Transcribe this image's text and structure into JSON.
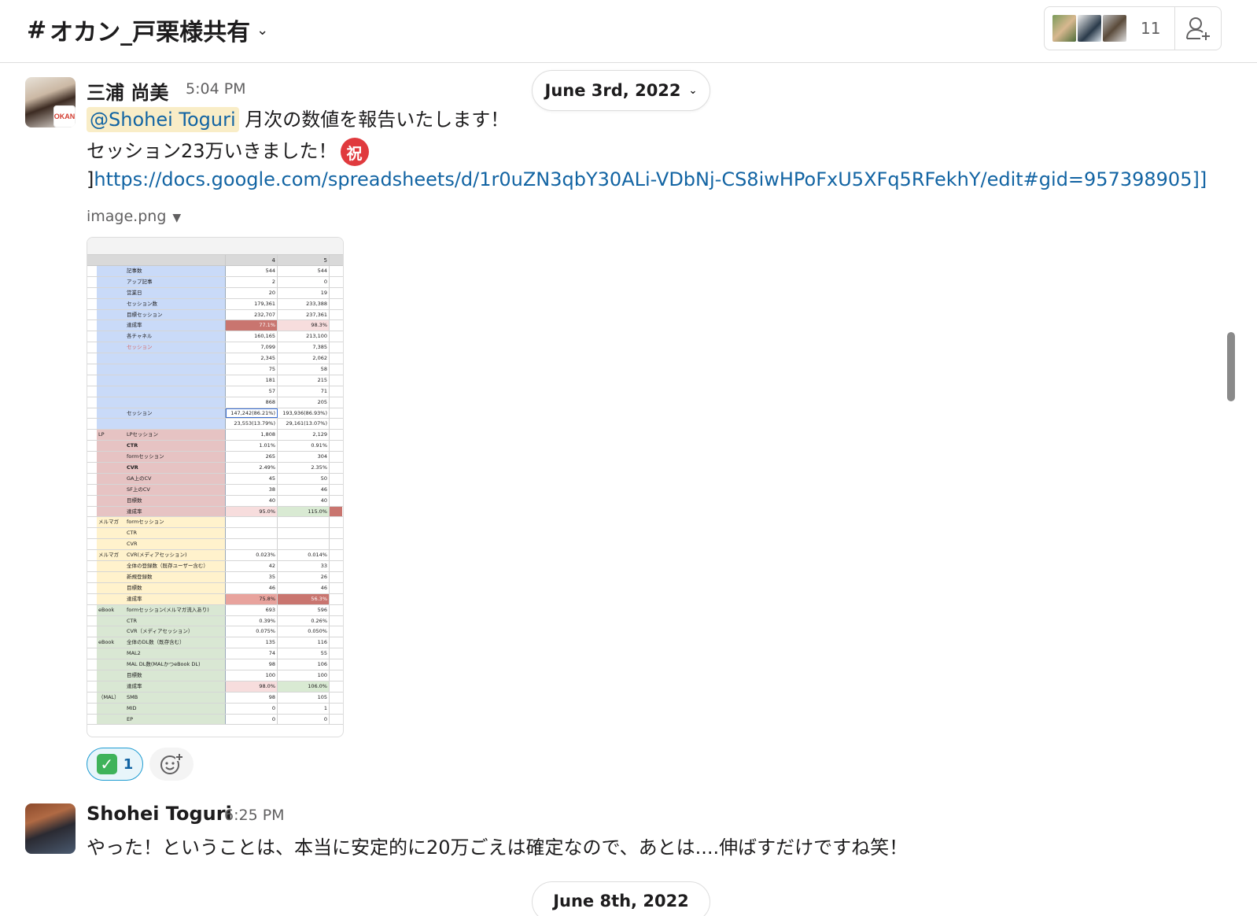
{
  "header": {
    "channel_hash": "#",
    "channel_name": "オカン_戸栗様共有",
    "member_count": "11"
  },
  "date_pills": {
    "top": "June 3rd, 2022",
    "bottom": "June 8th, 2022"
  },
  "messages": [
    {
      "sender": "三浦 尚美",
      "time": "5:04 PM",
      "avatar_badge": "OKAN",
      "mention": "@Shohei Toguri",
      "line1_rest": " 月次の数値を報告いたします！",
      "line2": "セッション23万いきました！",
      "emoji_iwai": "祝",
      "link_prefix": "]",
      "link": "https://docs.google.com/spreadsheets/d/1r0uZN3qbY30ALi-VDbNj-CS8iwHPoFxU5XFq5RFekhY/edit#gid=957398905]]",
      "file_name": "image.png",
      "reaction_count": "1"
    },
    {
      "sender": "Shohei Toguri",
      "time": "6:25 PM",
      "text": "やった！ということは、本当に安定的に20万ごえは確定なので、あとは....伸ばすだけですね笑！"
    }
  ],
  "sheet": {
    "col_headers": [
      "4",
      "5"
    ],
    "rows": [
      {
        "g": "blue",
        "a": "",
        "b": "記事数",
        "v1": "544",
        "v2": "544"
      },
      {
        "g": "blue",
        "a": "",
        "b": "アップ記事",
        "v1": "2",
        "v2": "0"
      },
      {
        "g": "blue",
        "a": "",
        "b": "営業日",
        "v1": "20",
        "v2": "19"
      },
      {
        "g": "blue",
        "a": "",
        "b": "セッション数",
        "v1": "179,361",
        "v2": "233,388"
      },
      {
        "g": "blue",
        "a": "",
        "b": "目標セッション",
        "v1": "232,707",
        "v2": "237,361"
      },
      {
        "g": "blue",
        "a": "",
        "b": "達成率",
        "v1": "77.1%",
        "v2": "98.3%",
        "h1": "hl-red",
        "h2": "hl-pink"
      },
      {
        "g": "blue",
        "a": "",
        "b": "各チャネル",
        "v1": "160,165",
        "v2": "213,100"
      },
      {
        "g": "blue",
        "a": "",
        "b": "セッション",
        "v1": "7,099",
        "v2": "7,385",
        "pink": true
      },
      {
        "g": "blue",
        "a": "",
        "b": "",
        "v1": "2,345",
        "v2": "2,062"
      },
      {
        "g": "blue",
        "a": "",
        "b": "",
        "v1": "75",
        "v2": "58"
      },
      {
        "g": "blue",
        "a": "",
        "b": "",
        "v1": "181",
        "v2": "215"
      },
      {
        "g": "blue",
        "a": "",
        "b": "",
        "v1": "57",
        "v2": "71"
      },
      {
        "g": "blue",
        "a": "",
        "b": "",
        "v1": "868",
        "v2": "205"
      },
      {
        "g": "blue",
        "a": "",
        "b": "セッション",
        "v1": "147,242(86.21%)",
        "v2": "193,936(86.93%)",
        "h1": "sel"
      },
      {
        "g": "blue",
        "a": "",
        "b": "",
        "v1": "23,553(13.79%)",
        "v2": "29,161(13.07%)"
      },
      {
        "g": "red",
        "a": "LP",
        "b": "LPセッション",
        "v1": "1,808",
        "v2": "2,129"
      },
      {
        "g": "red",
        "a": "",
        "b": "CTR",
        "v1": "1.01%",
        "v2": "0.91%",
        "bold": true
      },
      {
        "g": "red",
        "a": "",
        "b": "formセッション",
        "v1": "265",
        "v2": "304"
      },
      {
        "g": "red",
        "a": "",
        "b": "CVR",
        "v1": "2.49%",
        "v2": "2.35%",
        "bold": true
      },
      {
        "g": "red",
        "a": "",
        "b": "GA上のCV",
        "v1": "45",
        "v2": "50"
      },
      {
        "g": "red",
        "a": "",
        "b": "SF上のCV",
        "v1": "38",
        "v2": "46"
      },
      {
        "g": "red",
        "a": "",
        "b": "目標数",
        "v1": "40",
        "v2": "40"
      },
      {
        "g": "red",
        "a": "",
        "b": "達成率",
        "v1": "95.0%",
        "v2": "115.0%",
        "h1": "hl-pink",
        "h2": "hl-green"
      },
      {
        "g": "yellow",
        "a": "メルマガ",
        "b": "formセッション",
        "v1": "",
        "v2": ""
      },
      {
        "g": "yellow",
        "a": "",
        "b": "CTR",
        "v1": "",
        "v2": ""
      },
      {
        "g": "yellow",
        "a": "",
        "b": "CVR",
        "v1": "",
        "v2": ""
      },
      {
        "g": "yellow",
        "a": "メルマガ",
        "b": "CVR(メディアセッション)",
        "v1": "0.023%",
        "v2": "0.014%"
      },
      {
        "g": "yellow",
        "a": "",
        "b": "全体の登録数（既存ユーザー含む）",
        "v1": "42",
        "v2": "33"
      },
      {
        "g": "yellow",
        "a": "",
        "b": "新規登録数",
        "v1": "35",
        "v2": "26"
      },
      {
        "g": "yellow",
        "a": "",
        "b": "目標数",
        "v1": "46",
        "v2": "46"
      },
      {
        "g": "yellow",
        "a": "",
        "b": "達成率",
        "v1": "75.8%",
        "v2": "56.3%",
        "h1": "hl-mid",
        "h2": "hl-red"
      },
      {
        "g": "green",
        "a": "eBook",
        "b": "formセッション(メルマガ流入あり)",
        "v1": "693",
        "v2": "596"
      },
      {
        "g": "green",
        "a": "",
        "b": "CTR",
        "v1": "0.39%",
        "v2": "0.26%"
      },
      {
        "g": "green",
        "a": "",
        "b": "CVR（メディアセッション）",
        "v1": "0.075%",
        "v2": "0.050%"
      },
      {
        "g": "green",
        "a": "eBook",
        "b": "全体のDL数（既存含む）",
        "v1": "135",
        "v2": "116"
      },
      {
        "g": "green",
        "a": "",
        "b": "MAL2",
        "v1": "74",
        "v2": "55"
      },
      {
        "g": "green",
        "a": "",
        "b": "MAL DL数(MALかつeBook DL)",
        "v1": "98",
        "v2": "106"
      },
      {
        "g": "green",
        "a": "",
        "b": "目標数",
        "v1": "100",
        "v2": "100"
      },
      {
        "g": "green",
        "a": "",
        "b": "達成率",
        "v1": "98.0%",
        "v2": "106.0%",
        "h1": "hl-pink",
        "h2": "hl-green"
      },
      {
        "g": "green",
        "a": "（MAL）",
        "b": "SMB",
        "v1": "98",
        "v2": "105"
      },
      {
        "g": "green",
        "a": "",
        "b": "MID",
        "v1": "0",
        "v2": "1"
      },
      {
        "g": "green",
        "a": "",
        "b": "EP",
        "v1": "0",
        "v2": "0"
      }
    ]
  }
}
